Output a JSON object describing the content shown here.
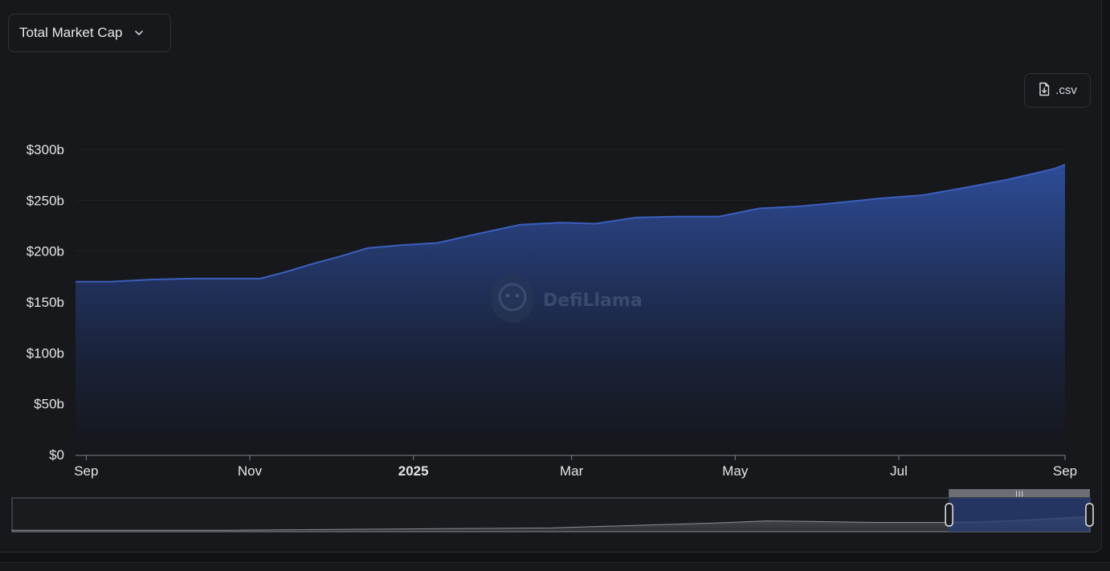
{
  "controls": {
    "metric_label": "Total Market Cap",
    "csv_label": ".csv",
    "chevron_icon": "chevron-down-icon",
    "download_icon": "file-download-icon"
  },
  "watermark": {
    "text": "DefiLlama",
    "icon": "llama-logo-icon"
  },
  "colors": {
    "background": "#17181b",
    "series_line": "#3b5fbf",
    "fill_top": "#2f4f9e",
    "fill_bottom": "#14161b",
    "text": "#e4e5e8"
  },
  "chart_data": {
    "type": "area",
    "title": "",
    "xlabel": "",
    "ylabel": "",
    "ylim": [
      0,
      300
    ],
    "y_unit": "b",
    "y_ticks": [
      "$0",
      "$50b",
      "$100b",
      "$150b",
      "$200b",
      "$250b",
      "$300b"
    ],
    "y_tick_values": [
      0,
      50,
      100,
      150,
      200,
      250,
      300
    ],
    "x_ticks": [
      {
        "label": "Sep",
        "date": "2024-09-01",
        "bold": false
      },
      {
        "label": "Nov",
        "date": "2024-11-01",
        "bold": false
      },
      {
        "label": "2025",
        "date": "2025-01-01",
        "bold": true
      },
      {
        "label": "Mar",
        "date": "2025-03-01",
        "bold": false
      },
      {
        "label": "May",
        "date": "2025-05-01",
        "bold": false
      },
      {
        "label": "Jul",
        "date": "2025-07-01",
        "bold": false
      },
      {
        "label": "Sep",
        "date": "2025-09-01",
        "bold": false
      }
    ],
    "xlim": [
      "2024-08-28",
      "2025-09-01"
    ],
    "grid": true,
    "legend": "none",
    "series": [
      {
        "x": [
          "2024-08-28",
          "2024-09-10",
          "2024-09-25",
          "2024-10-10",
          "2024-10-25",
          "2024-11-05",
          "2024-11-15",
          "2024-11-25",
          "2024-12-05",
          "2024-12-15",
          "2024-12-28",
          "2025-01-10",
          "2025-01-25",
          "2025-02-10",
          "2025-02-25",
          "2025-03-10",
          "2025-03-25",
          "2025-04-10",
          "2025-04-25",
          "2025-05-10",
          "2025-05-25",
          "2025-06-10",
          "2025-06-25",
          "2025-07-10",
          "2025-07-25",
          "2025-08-10",
          "2025-08-20",
          "2025-08-28",
          "2025-09-01"
        ],
        "values": [
          170,
          170,
          172,
          173,
          173,
          173,
          180,
          188,
          195,
          203,
          206,
          208,
          217,
          226,
          228,
          227,
          233,
          234,
          234,
          242,
          244,
          248,
          252,
          255,
          262,
          270,
          276,
          281,
          285
        ]
      }
    ],
    "range_selector": {
      "start": "2025-07-25",
      "end": "2025-09-01",
      "full_range_start": "2018-01-01",
      "full_range_end": "2025-09-01"
    }
  }
}
